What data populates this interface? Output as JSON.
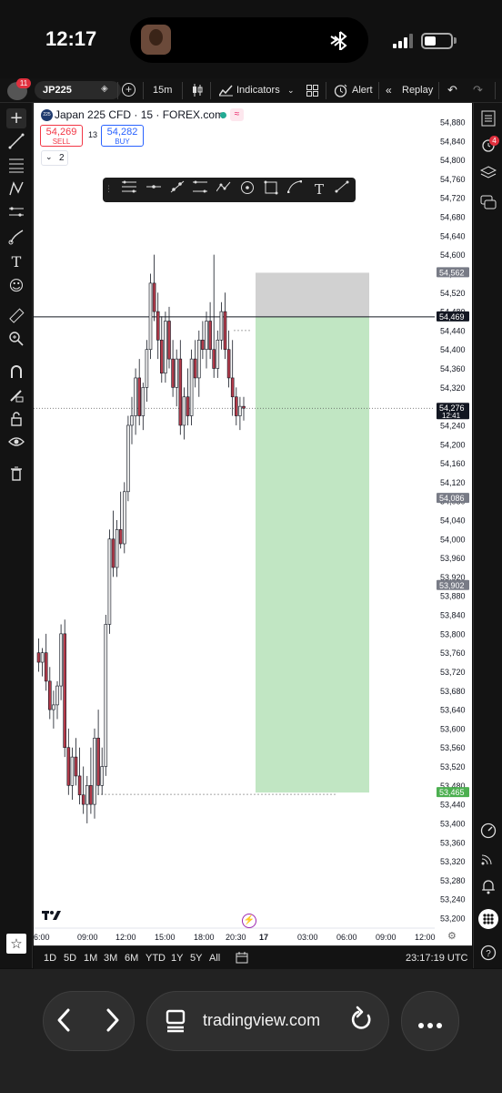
{
  "status_bar": {
    "time": "12:17",
    "signal_bars": 4,
    "signal_active": 3,
    "battery_level": 0.45
  },
  "toolbar": {
    "notification_count": "11",
    "symbol": "JP225",
    "interval": "15m",
    "indicators_label": "Indicators",
    "alert_label": "Alert",
    "replay_label": "Replay"
  },
  "legend": {
    "symbol_icon_text": "225",
    "title": "Japan 225 CFD · 15 · FOREX.com",
    "sell_price": "54,269",
    "sell_label": "SELL",
    "spread": "13",
    "buy_price": "54,282",
    "buy_label": "BUY",
    "collapsed_count": "2"
  },
  "right_toolbar": {
    "badge_count": "4"
  },
  "chart_data": {
    "type": "candlestick",
    "symbol": "Japan 225 CFD",
    "interval": "15",
    "source": "FOREX.com",
    "y_ticks": [
      54880,
      54840,
      54800,
      54760,
      54720,
      54680,
      54640,
      54600,
      54560,
      54520,
      54480,
      54440,
      54400,
      54360,
      54320,
      54280,
      54240,
      54200,
      54160,
      54120,
      54080,
      54040,
      54000,
      53960,
      53920,
      53880,
      53840,
      53800,
      53760,
      53720,
      53680,
      53640,
      53600,
      53560,
      53520,
      53480,
      53440,
      53400,
      53360,
      53320,
      53280,
      53240,
      53200
    ],
    "ylim": [
      53180,
      54900
    ],
    "x_labels": [
      "6:00",
      "09:00",
      "12:00",
      "15:00",
      "18:00",
      "20:30",
      "17",
      "03:00",
      "06:00",
      "09:00",
      "12:00"
    ],
    "price_labels": [
      {
        "text": "54,562",
        "value": 54562,
        "color": "#787b86"
      },
      {
        "text": "54,469",
        "value": 54469,
        "color": "#131722"
      },
      {
        "text": "54,276",
        "value": 54276,
        "color": "#131722",
        "countdown": "12:41"
      },
      {
        "text": "54,086",
        "value": 54086,
        "color": "#787b86"
      },
      {
        "text": "53,902",
        "value": 53902,
        "color": "#787b86"
      },
      {
        "text": "53,465",
        "value": 53465,
        "color": "#4caf50"
      }
    ],
    "horizontal_line": 54469,
    "current_price": 54276,
    "position": {
      "type": "short",
      "entry": 54469,
      "stop": 54562,
      "target": 53465,
      "profit_color": "#c1e6c3",
      "loss_color": "#d1d1d1"
    },
    "candles": [
      [
        53760,
        53790,
        53720,
        53740
      ],
      [
        53740,
        53770,
        53710,
        53760
      ],
      [
        53760,
        53800,
        53680,
        53700
      ],
      [
        53700,
        53730,
        53620,
        53640
      ],
      [
        53640,
        53680,
        53600,
        53650
      ],
      [
        53650,
        53700,
        53620,
        53690
      ],
      [
        53690,
        53820,
        53660,
        53800
      ],
      [
        53800,
        53830,
        53540,
        53560
      ],
      [
        53560,
        53600,
        53460,
        53480
      ],
      [
        53480,
        53560,
        53450,
        53540
      ],
      [
        53540,
        53580,
        53480,
        53500
      ],
      [
        53500,
        53560,
        53440,
        53460
      ],
      [
        53460,
        53520,
        53420,
        53440
      ],
      [
        53440,
        53500,
        53400,
        53480
      ],
      [
        53480,
        53560,
        53420,
        53440
      ],
      [
        53440,
        53600,
        53410,
        53580
      ],
      [
        53580,
        53640,
        53460,
        53480
      ],
      [
        53480,
        53560,
        53460,
        53520
      ],
      [
        53520,
        53840,
        53500,
        53820
      ],
      [
        53820,
        54020,
        53800,
        54000
      ],
      [
        54000,
        54060,
        53920,
        53940
      ],
      [
        53940,
        54040,
        53920,
        54020
      ],
      [
        54020,
        54100,
        53980,
        53990
      ],
      [
        53990,
        54120,
        53970,
        54100
      ],
      [
        54100,
        54260,
        54080,
        54240
      ],
      [
        54240,
        54300,
        54200,
        54260
      ],
      [
        54260,
        54360,
        54220,
        54340
      ],
      [
        54340,
        54380,
        54240,
        54260
      ],
      [
        54260,
        54330,
        54230,
        54320
      ],
      [
        54320,
        54420,
        54290,
        54400
      ],
      [
        54400,
        54560,
        54380,
        54540
      ],
      [
        54540,
        54600,
        54460,
        54480
      ],
      [
        54480,
        54520,
        54380,
        54420
      ],
      [
        54420,
        54470,
        54330,
        54350
      ],
      [
        54350,
        54480,
        54330,
        54460
      ],
      [
        54460,
        54490,
        54360,
        54380
      ],
      [
        54380,
        54420,
        54300,
        54320
      ],
      [
        54320,
        54400,
        54280,
        54380
      ],
      [
        54380,
        54420,
        54220,
        54240
      ],
      [
        54240,
        54320,
        54210,
        54300
      ],
      [
        54300,
        54360,
        54240,
        54260
      ],
      [
        54260,
        54400,
        54240,
        54380
      ],
      [
        54380,
        54420,
        54320,
        54340
      ],
      [
        54340,
        54440,
        54300,
        54420
      ],
      [
        54420,
        54460,
        54380,
        54400
      ],
      [
        54400,
        54480,
        54360,
        54460
      ],
      [
        54460,
        54500,
        54380,
        54400
      ],
      [
        54400,
        54600,
        54340,
        54360
      ],
      [
        54360,
        54440,
        54340,
        54420
      ],
      [
        54420,
        54500,
        54400,
        54480
      ],
      [
        54480,
        54520,
        54380,
        54400
      ],
      [
        54400,
        54440,
        54320,
        54340
      ],
      [
        54340,
        54420,
        54260,
        54300
      ],
      [
        54300,
        54320,
        54240,
        54260
      ],
      [
        54260,
        54300,
        54230,
        54280
      ],
      [
        54280,
        54300,
        54250,
        54276
      ]
    ]
  },
  "time_periods": [
    "1D",
    "5D",
    "1M",
    "3M",
    "6M",
    "YTD",
    "1Y",
    "5Y",
    "All"
  ],
  "timestamp": "23:17:19 UTC",
  "browser": {
    "url": "tradingview.com"
  }
}
